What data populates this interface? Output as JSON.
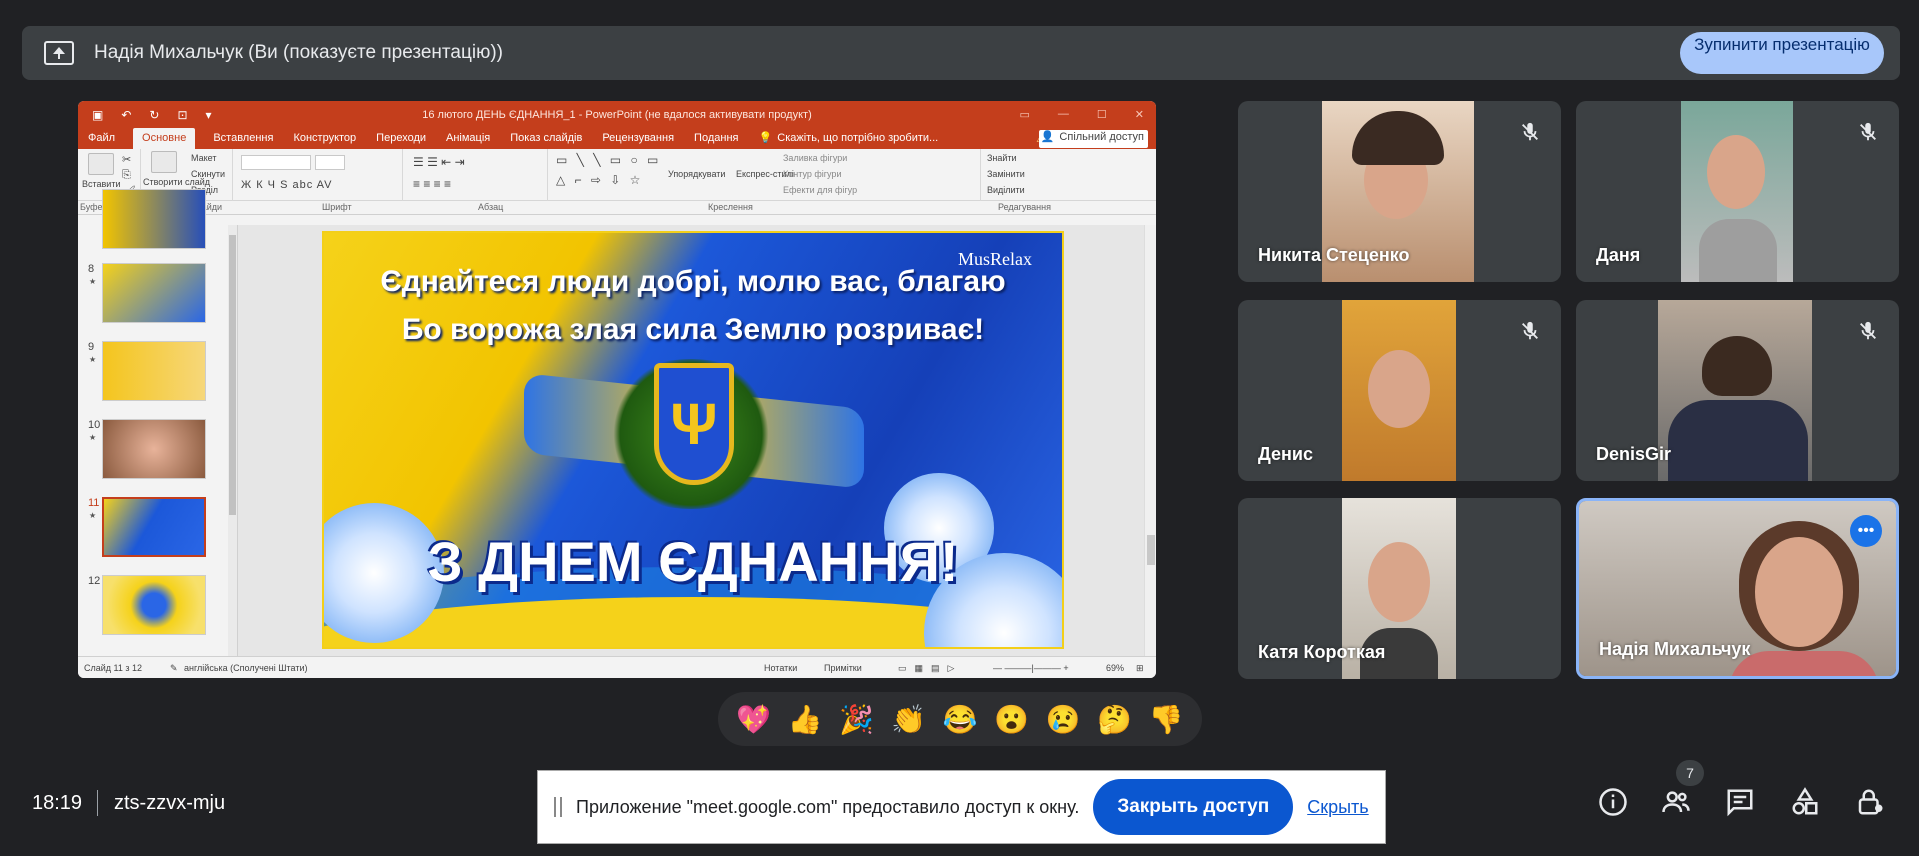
{
  "presenting_bar": {
    "title": "Надія Михальчук (Ви (показуєте презентацію))",
    "stop_label": "Зупинити презентацію"
  },
  "powerpoint": {
    "window_title": "16 лютого ДЕНЬ ЄДНАННЯ_1 - PowerPoint (не вдалося активувати продукт)",
    "tabs": [
      "Файл",
      "Основне",
      "Вставлення",
      "Конструктор",
      "Переходи",
      "Анімація",
      "Показ слайдів",
      "Рецензування",
      "Подання"
    ],
    "active_tab": "Основне",
    "tell_me": "Скажіть, що потрібно зробити...",
    "share": "Спільний доступ",
    "ribbon": {
      "paste": "Вставити",
      "new_slide": "Створити слайд",
      "layout": "Макет",
      "reset": "Скинути",
      "section": "Розділ",
      "arrange": "Упорядкувати",
      "quick_styles": "Експрес-стилі",
      "shape_fill": "Заливка фігури",
      "shape_outline": "Контур фігури",
      "shape_effects": "Ефекти для фігур",
      "find": "Знайти",
      "replace": "Замінити",
      "select": "Виділити",
      "font_format": "Ж  К  Ч  S  abc  AV",
      "group_labels": [
        "Буфер обміну",
        "Слайди",
        "Шрифт",
        "Абзац",
        "Креслення",
        "Редагування"
      ]
    },
    "thumbnails": [
      {
        "num": "8"
      },
      {
        "num": "9"
      },
      {
        "num": "10"
      },
      {
        "num": "11"
      },
      {
        "num": "12"
      }
    ],
    "slide": {
      "line1": "Єднайтеся люди добрі, молю вас, благаю",
      "line2": "Бо ворожа злая сила Землю розриває!",
      "brand": "MusRelax",
      "headline": "З ДНЕМ ЄДНАННЯ!",
      "trident": "Ψ"
    },
    "status": {
      "slide_info": "Слайд 11 з 12",
      "language": "англійська (Сполучені Штати)",
      "notes": "Нотатки",
      "comments": "Примітки",
      "zoom": "69%"
    }
  },
  "participants": [
    {
      "name": "Никита Стеценко",
      "muted": true
    },
    {
      "name": "Даня",
      "muted": true
    },
    {
      "name": "Денис",
      "muted": true
    },
    {
      "name": "DenisGir",
      "muted": true
    },
    {
      "name": "Катя Короткая",
      "muted": false
    },
    {
      "name": "Надія Михальчук",
      "muted": false
    }
  ],
  "reactions": [
    "💖",
    "👍",
    "🎉",
    "👏",
    "😂",
    "😮",
    "😢",
    "🤔",
    "👎"
  ],
  "bottom": {
    "time": "18:19",
    "meeting_code": "zts-zzvx-mju",
    "people_count": "7"
  },
  "notification": {
    "text": "Приложение \"meet.google.com\" предоставило доступ к окну.",
    "close_label": "Закрыть доступ",
    "hide_label": "Скрыть"
  },
  "colors": {
    "background": "#202124",
    "tile": "#3c4043",
    "accent": "#8ab4f8",
    "ppt_brand": "#c43e1c",
    "primary_button": "#0b57d0"
  }
}
